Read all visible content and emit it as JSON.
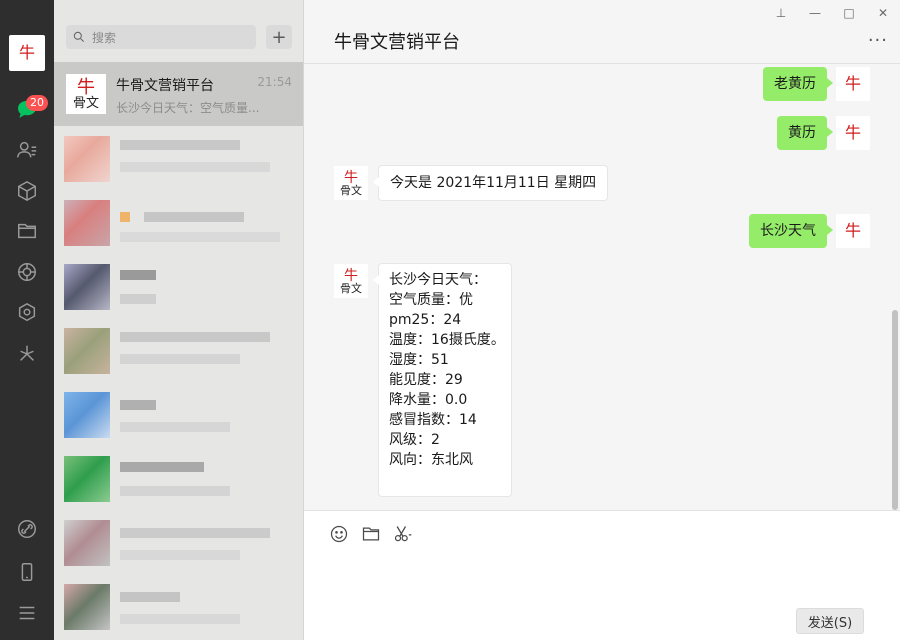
{
  "colors": {
    "rail": "#2e2e2e",
    "list": "#e6e6e5",
    "chat": "#f5f5f5",
    "bubble_me": "#95ec69",
    "badge": "#fa5151"
  },
  "rail": {
    "badge": "20",
    "items": [
      {
        "icon": "chat-icon"
      },
      {
        "icon": "contacts-icon"
      },
      {
        "icon": "cube-icon"
      },
      {
        "icon": "folder-icon"
      },
      {
        "icon": "aperture-icon"
      },
      {
        "icon": "hexagon-icon"
      },
      {
        "icon": "sparkle-icon"
      },
      {
        "icon": "link-icon"
      },
      {
        "icon": "phone-icon"
      },
      {
        "icon": "menu-icon"
      }
    ]
  },
  "search": {
    "placeholder": "搜索",
    "add_label": "+"
  },
  "conversation": {
    "name": "牛骨文营销平台",
    "time": "21:54",
    "preview": "长沙今日天气：空气质量..."
  },
  "window_controls": {
    "pin": "⊥",
    "minimize": "—",
    "maximize": "□",
    "close": "✕"
  },
  "chat": {
    "title": "牛骨文营销平台",
    "more": "···",
    "messages": [
      {
        "from": "me",
        "text": "老黄历"
      },
      {
        "from": "me",
        "text": "黄历"
      },
      {
        "from": "them",
        "text": "今天是 2021年11月11日 星期四"
      },
      {
        "from": "me",
        "text": "长沙天气"
      },
      {
        "from": "them",
        "lines": [
          "长沙今日天气：",
          "空气质量：优",
          "pm25：24",
          "温度：16摄氏度。",
          "湿度：51",
          "能见度：29",
          "降水量：0.0",
          "感冒指数：14",
          "风级：2",
          "风向：东北风"
        ]
      }
    ]
  },
  "input": {
    "tools": [
      "emoji-icon",
      "folder-icon",
      "scissors-icon"
    ],
    "send_label": "发送(S)"
  }
}
